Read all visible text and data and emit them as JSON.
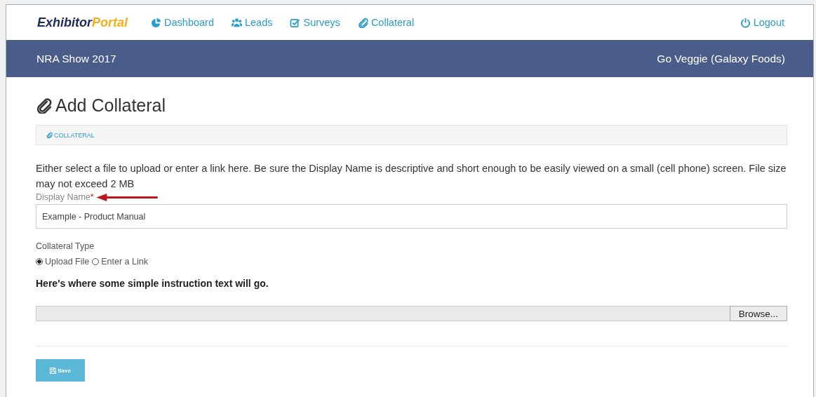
{
  "logo": {
    "first": "Exhibitor",
    "second": "Portal"
  },
  "nav": [
    {
      "kind": "dashboard",
      "label": "Dashboard"
    },
    {
      "kind": "leads",
      "label": "Leads"
    },
    {
      "kind": "surveys",
      "label": "Surveys"
    },
    {
      "kind": "collateral",
      "label": "Collateral"
    }
  ],
  "logout": "Logout",
  "banner": {
    "event": "NRA Show 2017",
    "company": "Go Veggie (Galaxy Foods)"
  },
  "page_title": "Add Collateral",
  "breadcrumb": "COLLATERAL",
  "intro": "Either select a file to upload or enter a link here. Be sure the Display Name is descriptive and short enough to be easily viewed on a small (cell phone) screen. File size may not exceed 2 MB",
  "display_name": {
    "label": "Display Name",
    "required_mark": "*",
    "value": "Example - Product Manual"
  },
  "collateral_type": {
    "label": "Collateral Type",
    "options": [
      {
        "label": "Upload File",
        "selected": true
      },
      {
        "label": "Enter a Link",
        "selected": false
      }
    ]
  },
  "instruction": "Here's where some simple instruction text will go.",
  "browse_button": "Browse...",
  "save_button": "Save"
}
